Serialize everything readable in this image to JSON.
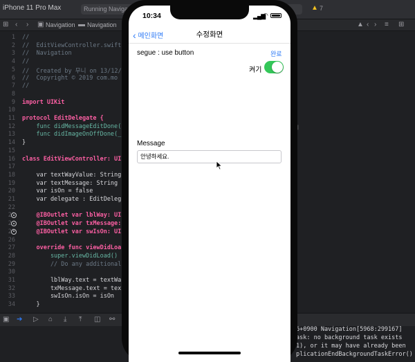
{
  "xcode": {
    "device": "iPhone 11 Pro Max",
    "status": "Running Navigati",
    "warning_count": "7",
    "jumpbar": [
      "Navigation",
      "Navigation"
    ]
  },
  "code_lines": [
    {
      "n": "1",
      "t": "//",
      "cls": "cm"
    },
    {
      "n": "2",
      "t": "//  EditViewController.swift",
      "cls": "cm"
    },
    {
      "n": "3",
      "t": "//  Navigation",
      "cls": "cm"
    },
    {
      "n": "4",
      "t": "//",
      "cls": "cm"
    },
    {
      "n": "5",
      "t": "//  Created by 무니 on 13/12/",
      "cls": "cm"
    },
    {
      "n": "6",
      "t": "//  Copyright © 2019 com.mo",
      "cls": "cm"
    },
    {
      "n": "7",
      "t": "//",
      "cls": "cm"
    },
    {
      "n": "8",
      "t": "",
      "cls": ""
    },
    {
      "n": "9",
      "t": "import UIKit",
      "cls": "kw"
    },
    {
      "n": "10",
      "t": "",
      "cls": ""
    },
    {
      "n": "11",
      "t": "protocol EditDelegate {",
      "cls": "kw"
    },
    {
      "n": "12",
      "t": "    func didMessageEditDone(",
      "cls": "pl"
    },
    {
      "n": "13",
      "t": "    func didImageOnOffDone(_",
      "cls": "pl"
    },
    {
      "n": "14",
      "t": "}",
      "cls": ""
    },
    {
      "n": "15",
      "t": "",
      "cls": ""
    },
    {
      "n": "16",
      "t": "class EditViewController: UI",
      "cls": "kw"
    },
    {
      "n": "17",
      "t": "",
      "cls": ""
    },
    {
      "n": "18",
      "t": "    var textWayValue: String",
      "cls": ""
    },
    {
      "n": "19",
      "t": "    var textMessage: String",
      "cls": ""
    },
    {
      "n": "20",
      "t": "    var isOn = false",
      "cls": ""
    },
    {
      "n": "21",
      "t": "    var delegate : EditDeleg",
      "cls": ""
    },
    {
      "n": "22",
      "t": "",
      "cls": ""
    },
    {
      "n": "23",
      "t": "    @IBOutlet var lblWay: UI",
      "cls": "kw"
    },
    {
      "n": "24",
      "t": "    @IBOutlet var txMessage:",
      "cls": "kw"
    },
    {
      "n": "25",
      "t": "    @IBOutlet var swIsOn: UI",
      "cls": "kw"
    },
    {
      "n": "26",
      "t": "",
      "cls": ""
    },
    {
      "n": "27",
      "t": "    override func viewDidLoa",
      "cls": "kw"
    },
    {
      "n": "28",
      "t": "        super.viewDidLoad()",
      "cls": "pl"
    },
    {
      "n": "29",
      "t": "        // Do any additional",
      "cls": "cm"
    },
    {
      "n": "30",
      "t": "",
      "cls": ""
    },
    {
      "n": "31",
      "t": "        lblWay.text = textWa",
      "cls": ""
    },
    {
      "n": "32",
      "t": "        txMessage.text = tex",
      "cls": ""
    },
    {
      "n": "33",
      "t": "        swIsOn.isOn = isOn",
      "cls": ""
    },
    {
      "n": "34",
      "t": "    }",
      "cls": ""
    }
  ],
  "console": [
    "6+0900 Navigation[5968:299167]",
    "ask: no background task exists",
    "1), or it may have already been",
    "plicationEndBackgroundTaskError()"
  ],
  "phone": {
    "time": "10:34",
    "nav": {
      "back": "메인화면",
      "title": "수정화면"
    },
    "segue_label": "segue : use button",
    "done_button": "완료",
    "switch_label": "켜기",
    "switch_on": true,
    "message_label": "Message",
    "message_value": "안녕하세요."
  },
  "colors": {
    "accent": "#2f7bf6",
    "switch_on": "#34c759"
  }
}
